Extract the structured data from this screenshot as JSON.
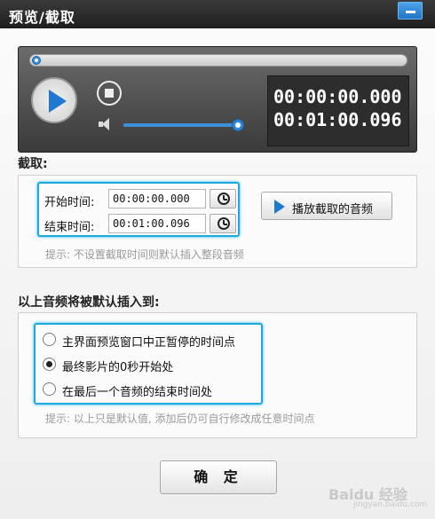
{
  "window": {
    "title": "预览/截取"
  },
  "player": {
    "current_time": "00:00:00.000",
    "total_time": "00:01:00.096",
    "seek_progress": 0,
    "volume_level": 1.0
  },
  "clip": {
    "section_label": "截取:",
    "start_label": "开始时间:",
    "start_value": "00:00:00.000",
    "end_label": "结束时间:",
    "end_value": "00:01:00.096",
    "play_clip_label": "播放截取的音频",
    "hint": "提示: 不设置截取时间则默认插入整段音频"
  },
  "insert": {
    "section_label": "以上音频将被默认插入到:",
    "options": [
      {
        "label": "主界面预览窗口中正暂停的时间点",
        "selected": false
      },
      {
        "label": "最终影片的0秒开始处",
        "selected": true
      },
      {
        "label": "在最后一个音频的结束时间处",
        "selected": false
      }
    ],
    "hint": "提示: 以上只是默认值, 添加后仍可自行修改成任意时间点"
  },
  "footer": {
    "ok_label": "确 定"
  },
  "watermark": {
    "text": "Baidu 经验",
    "sub": "jingyan.baidu.com"
  },
  "colors": {
    "accent": "#1ea8e0",
    "play_blue": "#1f78d1"
  }
}
